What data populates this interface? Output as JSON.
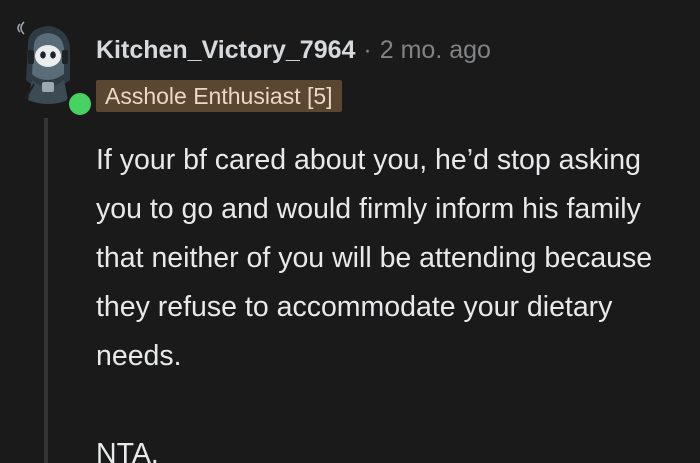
{
  "comment": {
    "username": "Kitchen_Victory_7964",
    "separator": "·",
    "timestamp": "2 mo. ago",
    "flair": "Asshole Enthusiast [5]",
    "body_paragraph": "If your bf cared about you, he’d stop asking you to go and would firmly inform his family that neither of you will be attending because they refuse to accommodate your dietary needs.",
    "verdict": "NTA.",
    "avatar_icon": "snoo-avatar-icon",
    "online_icon": "online-status-icon"
  },
  "colors": {
    "background": "#1a1a1b",
    "text": "#d7dadc",
    "muted": "#818384",
    "flair_bg": "#5a4631",
    "online": "#46d160",
    "thread_line": "#343536"
  }
}
